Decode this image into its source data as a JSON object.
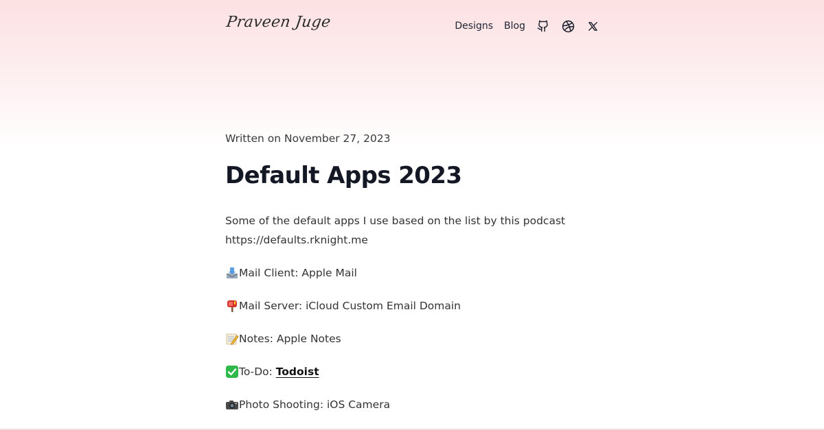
{
  "header": {
    "logo_text": "Praveen Juge",
    "nav": {
      "designs_label": "Designs",
      "blog_label": "Blog"
    },
    "icons": [
      "github-icon",
      "dribbble-icon",
      "x-twitter-icon"
    ]
  },
  "post": {
    "date": "Written on November 27, 2023",
    "title": "Default Apps 2023",
    "intro": "Some of the default apps I use based on the list by this podcast https://defaults.rknight.me",
    "items": [
      {
        "icon": "incoming-envelope-emoji",
        "text": "Mail Client: Apple Mail"
      },
      {
        "icon": "mailbox-emoji",
        "text": "Mail Server: iCloud Custom Email Domain"
      },
      {
        "icon": "memo-emoji",
        "text": "Notes: Apple Notes"
      },
      {
        "icon": "check-mark-button-emoji",
        "prefix": "To-Do: ",
        "link_text": "Todoist"
      },
      {
        "icon": "camera-emoji",
        "text": "Photo Shooting: iOS Camera"
      }
    ]
  },
  "colors": {
    "gradient_top": "#fde1e3",
    "title": "#141824",
    "body_text": "#333333",
    "check_green": "#2fb94a",
    "mailbox_red": "#d6302b"
  }
}
